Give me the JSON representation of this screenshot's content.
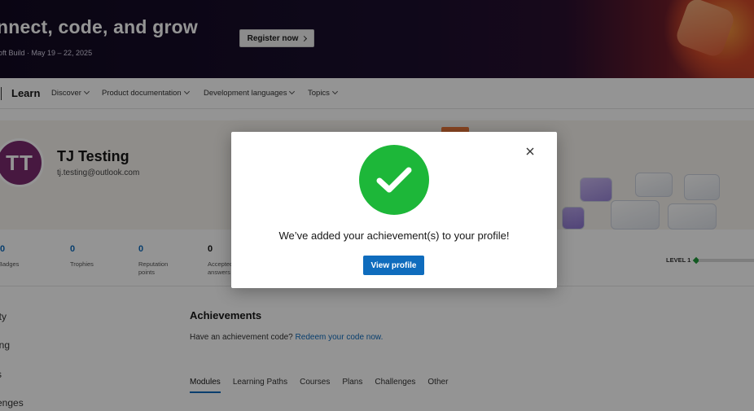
{
  "banner": {
    "title": "nnect, code, and grow",
    "subtitle": "oft Build · May 19 – 22, 2025",
    "register_label": "Register now"
  },
  "nav": {
    "brand": "Learn",
    "items": [
      {
        "label": "Discover"
      },
      {
        "label": "Product documentation"
      },
      {
        "label": "Development languages"
      },
      {
        "label": "Topics"
      }
    ]
  },
  "profile": {
    "initials": "TT",
    "name": "TJ Testing",
    "email": "tj.testing@outlook.com"
  },
  "stats": [
    {
      "value": "0",
      "label": "Badges"
    },
    {
      "value": "0",
      "label": "Trophies"
    },
    {
      "value": "0",
      "label": "Reputation points"
    },
    {
      "value": "0",
      "label": "Accepted answers"
    }
  ],
  "level": {
    "label": "LEVEL 1"
  },
  "sidebar": {
    "items": [
      {
        "label": "ity"
      },
      {
        "label": "ing"
      },
      {
        "label": "s"
      },
      {
        "label": "enges"
      }
    ]
  },
  "achievements": {
    "heading": "Achievements",
    "code_prompt": "Have an achievement code?",
    "code_link": "Redeem your code now.",
    "tabs": [
      {
        "label": "Modules"
      },
      {
        "label": "Learning Paths"
      },
      {
        "label": "Courses"
      },
      {
        "label": "Plans"
      },
      {
        "label": "Challenges"
      },
      {
        "label": "Other"
      }
    ]
  },
  "modal": {
    "message": "We’ve added your achievement(s) to your profile!",
    "button_label": "View profile",
    "success_color": "#1db739",
    "button_color": "#0f6cbd",
    "icons": {
      "close": "close-icon",
      "check": "checkmark-icon"
    }
  }
}
